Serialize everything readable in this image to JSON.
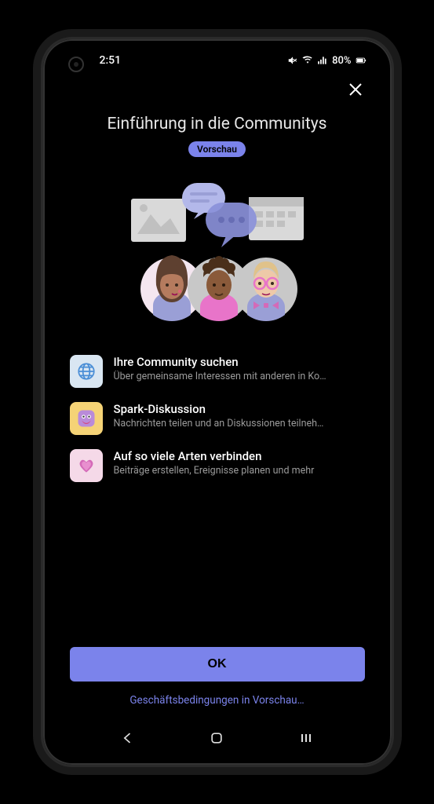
{
  "status": {
    "time": "2:51",
    "battery": "80%"
  },
  "modal": {
    "title": "Einführung in die Communitys",
    "badge": "Vorschau",
    "features": [
      {
        "title": "Ihre Community suchen",
        "desc": "Über gemeinsame Interessen mit anderen in Ko…"
      },
      {
        "title": "Spark-Diskussion",
        "desc": "Nachrichten teilen und an Diskussionen teilneh…"
      },
      {
        "title": "Auf so viele Arten verbinden",
        "desc": "Beiträge erstellen, Ereignisse planen und mehr"
      }
    ],
    "ok_label": "OK",
    "terms_label": "Geschäftsbedingungen in Vorschau…"
  }
}
